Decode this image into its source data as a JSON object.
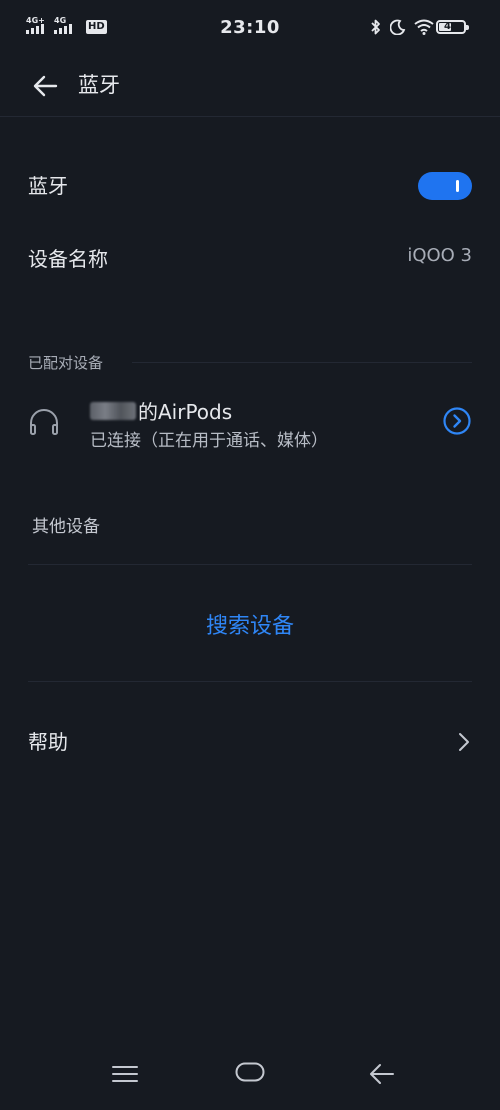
{
  "status_bar": {
    "sim1_label": "4G+",
    "sim2_label": "4G",
    "hd_label": "HD",
    "time": "23:10",
    "battery_level": "45",
    "icons": [
      "bluetooth-icon",
      "moon-icon",
      "wifi-icon",
      "battery-icon"
    ]
  },
  "header": {
    "title": "蓝牙"
  },
  "bluetooth": {
    "label": "蓝牙",
    "enabled": true
  },
  "device_name": {
    "label": "设备名称",
    "value": "iQOO 3"
  },
  "paired": {
    "section_label": "已配对设备",
    "devices": [
      {
        "name": "的AirPods",
        "status": "已连接（正在用于通话、媒体）",
        "icon": "headphones-icon"
      }
    ]
  },
  "other": {
    "section_label": "其他设备",
    "search_label": "搜索设备"
  },
  "help": {
    "label": "帮助"
  },
  "colors": {
    "background": "#161a21",
    "accent": "#1f74f0",
    "link": "#2f86f6"
  }
}
